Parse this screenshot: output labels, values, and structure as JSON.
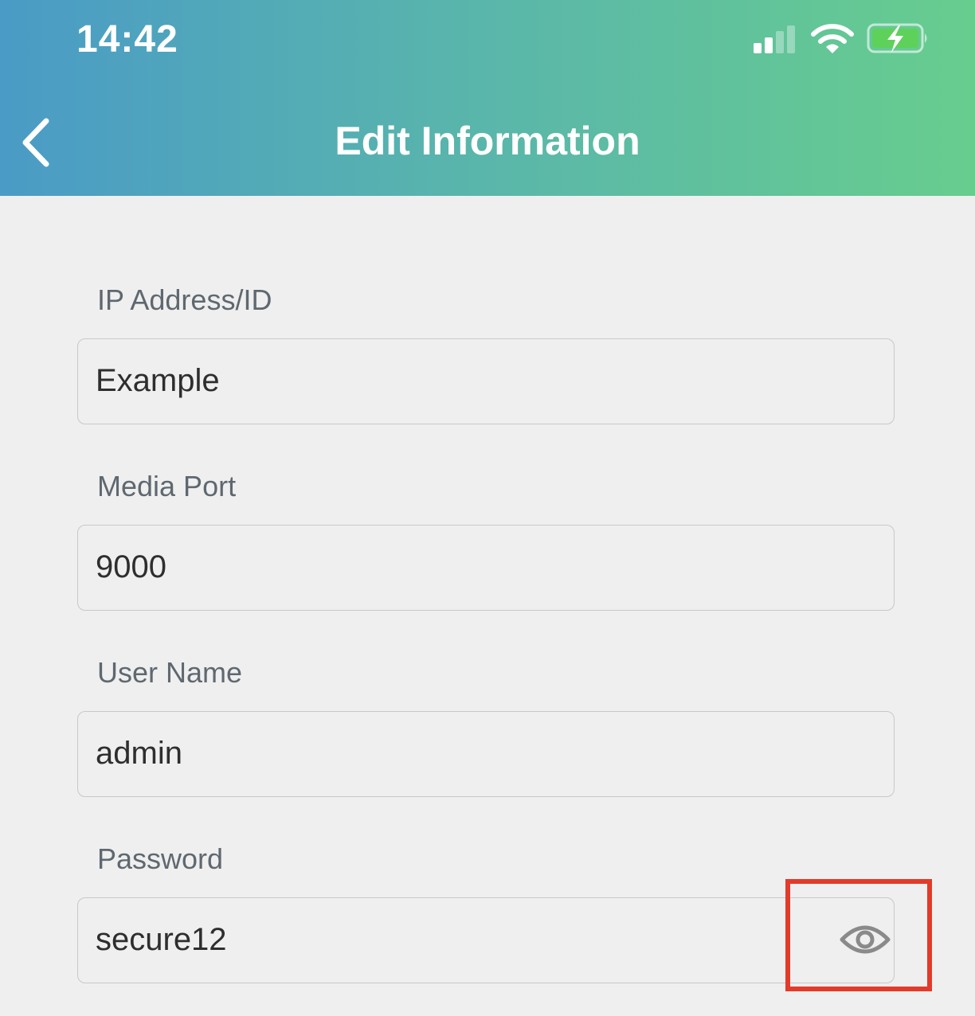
{
  "status_bar": {
    "time": "14:42",
    "icons": [
      "cellular-signal-icon",
      "wifi-icon",
      "battery-charging-icon"
    ]
  },
  "nav": {
    "back_icon": "chevron-left-icon",
    "title": "Edit Information"
  },
  "form": {
    "fields": [
      {
        "label": "IP Address/ID",
        "value": "Example"
      },
      {
        "label": "Media Port",
        "value": "9000"
      },
      {
        "label": "User Name",
        "value": "admin"
      },
      {
        "label": "Password",
        "value": "secure12",
        "trailing_icon": "eye-icon"
      }
    ]
  },
  "colors": {
    "header_gradient_start": "#4a9bc6",
    "header_gradient_end": "#67cd8e",
    "background": "#efefef",
    "label_text": "#5f6870",
    "value_text": "#2e2e2e",
    "highlight": "#e33a2a",
    "battery_fill": "#5ed15b"
  }
}
